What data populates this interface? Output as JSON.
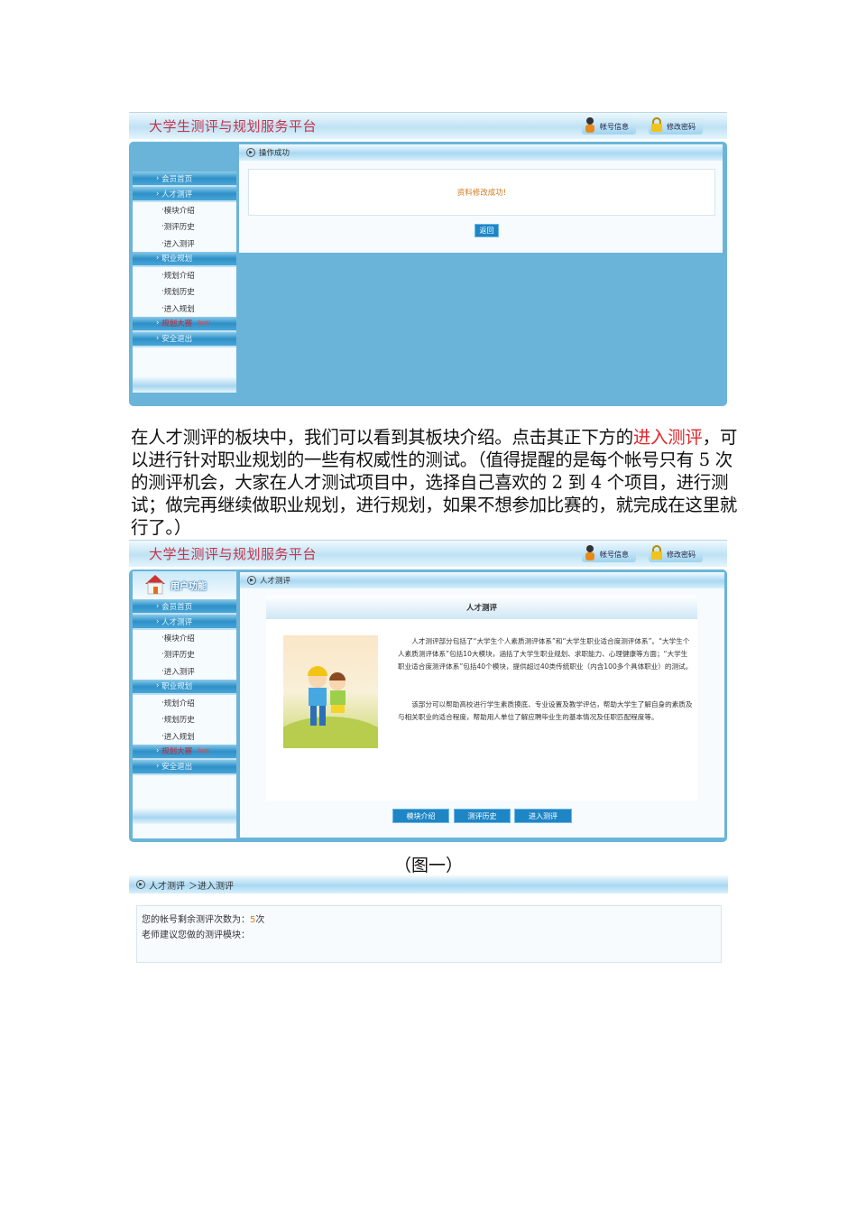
{
  "app": {
    "title": "大学生测评与规划服务平台",
    "account_btn": "帐号信息",
    "password_btn": "修改密码"
  },
  "sidebar": {
    "header": "用户功能",
    "items": [
      {
        "label": "会员首页"
      },
      {
        "label": "人才测评"
      },
      {
        "label": "模块介绍"
      },
      {
        "label": "测评历史"
      },
      {
        "label": "进入测评"
      },
      {
        "label": "职业规划"
      },
      {
        "label": "规划介绍"
      },
      {
        "label": "规划历史"
      },
      {
        "label": "进入规划"
      },
      {
        "label": "规划大赛",
        "badge": "hot!"
      },
      {
        "label": "安全退出"
      }
    ]
  },
  "shot1": {
    "panel_title": "操作成功",
    "message": "资料修改成功!",
    "back_btn": "返回"
  },
  "paragraph": {
    "part1": "在人才测评的板块中，我们可以看到其板块介绍。点击其正下方的",
    "link": "进入测评",
    "part2": "，可以进行针对职业规划的一些有权威性的测试。（值得提醒的是每个帐号只有 5 次的测评机会，大家在人才测试项目中，选择自己喜欢的 2 到 4 个项目，进行测试；做完再继续做职业规划，进行规划，如果不想参加比赛的，就完成在这里就行了。）"
  },
  "shot2": {
    "panel_title": "人才测评",
    "article_title": "人才测评",
    "text1": "人才测评部分包括了“大学生个人素质测评体系”和“大学生职业适合度测评体系”。“大学生个人素质测评体系”包括10大模块，涵括了大学生职业规划、求职能力、心理健康等方面；“大学生职业适合度测评体系”包括40个模块，提供超过40类传统职业（内含100多个具体职业）的测试。",
    "text2": "该部分可以帮助高校进行学生素质摸底、专业设置及教学评估，帮助大学生了解自身的素质及与相关职业的适合程度，帮助用人单位了解应聘毕业生的基本情况及任职匹配程度等。",
    "buttons": [
      "模块介绍",
      "测评历史",
      "进入测评"
    ]
  },
  "caption": "（图一）",
  "shot3": {
    "breadcrumb_1": "人才测评",
    "breadcrumb_2": "＞进入测评",
    "remaining_label": "您的帐号剩余测评次数为：",
    "remaining_value": "5",
    "remaining_unit": "次",
    "suggest_label": "老师建议您做的测评模块："
  }
}
